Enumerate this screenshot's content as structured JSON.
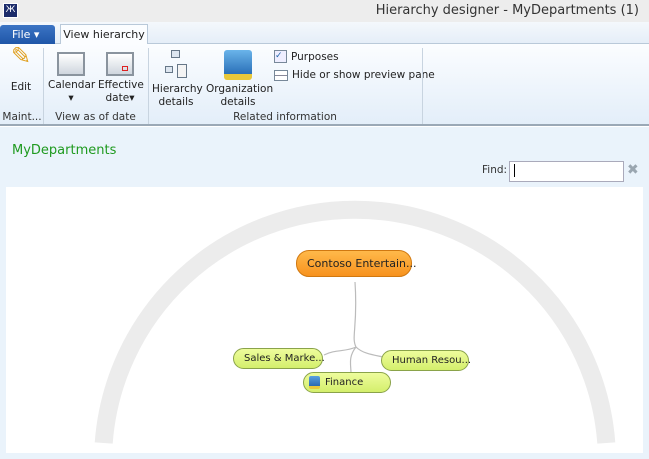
{
  "window": {
    "title": "Hierarchy designer - MyDepartments (1)"
  },
  "tabs": {
    "file": "File",
    "view_hierarchy": "View hierarchy"
  },
  "ribbon": {
    "edit": "Edit",
    "group_maintain": "Maint...",
    "calendar": "Calendar",
    "effective_date": "Effective date",
    "group_view": "View as of date",
    "hierarchy_details": "Hierarchy details",
    "organization_details": "Organization details",
    "purposes": "Purposes",
    "hide_show_preview": "Hide or show preview pane",
    "group_related": "Related information"
  },
  "page": {
    "heading": "MyDepartments",
    "find_label": "Find:",
    "find_value": ""
  },
  "hierarchy": {
    "root": "Contoso Entertain...",
    "children": [
      "Sales & Marke...",
      "Finance",
      "Human Resou..."
    ]
  }
}
